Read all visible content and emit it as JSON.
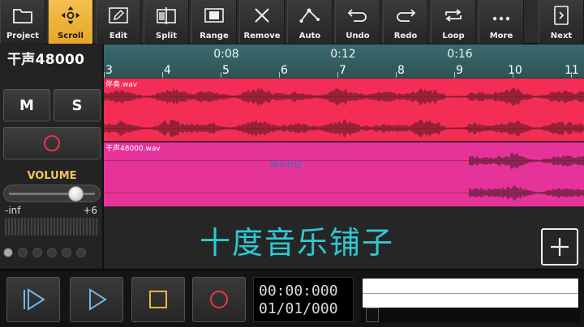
{
  "toolbar": {
    "buttons": [
      {
        "label": "Project",
        "icon": "folder-icon"
      },
      {
        "label": "Scroll",
        "icon": "move-icon",
        "active": true
      },
      {
        "label": "Edit",
        "icon": "pencil-icon"
      },
      {
        "label": "Split",
        "icon": "split-icon"
      },
      {
        "label": "Range",
        "icon": "range-icon"
      },
      {
        "label": "Remove",
        "icon": "close-icon"
      },
      {
        "label": "Auto",
        "icon": "automation-icon"
      },
      {
        "label": "Undo",
        "icon": "undo-icon"
      },
      {
        "label": "Redo",
        "icon": "redo-icon"
      },
      {
        "label": "Loop",
        "icon": "loop-icon"
      },
      {
        "label": "More",
        "icon": "more-icon"
      },
      {
        "label": "Next",
        "icon": "next-page-icon"
      }
    ]
  },
  "track": {
    "name": "干声48000",
    "mute_label": "M",
    "solo_label": "S",
    "volume_label": "VOLUME",
    "volume_min": "-inf",
    "volume_max": "+6",
    "volume_level": 0.78
  },
  "timeline": {
    "time_markers": [
      "0:08",
      "0:12",
      "0:16"
    ],
    "beat_markers": [
      "3",
      "4",
      "5",
      "6",
      "7",
      "8",
      "9",
      "10",
      "11"
    ]
  },
  "clips": [
    {
      "name": "伴奏.wav"
    },
    {
      "name": "干声48000.wav"
    }
  ],
  "watermark_small": "绵羊社区",
  "watermark_big": "十度音乐铺子",
  "transport": {
    "time": "00:00:000",
    "position": "01/01/000"
  },
  "colors": {
    "accent": "#f0b33c",
    "clip1": "#f42d55",
    "clip2": "#e6339a",
    "ruler": "#3b6a6e",
    "watermark": "#2fc8d4",
    "record": "#e8364a"
  }
}
